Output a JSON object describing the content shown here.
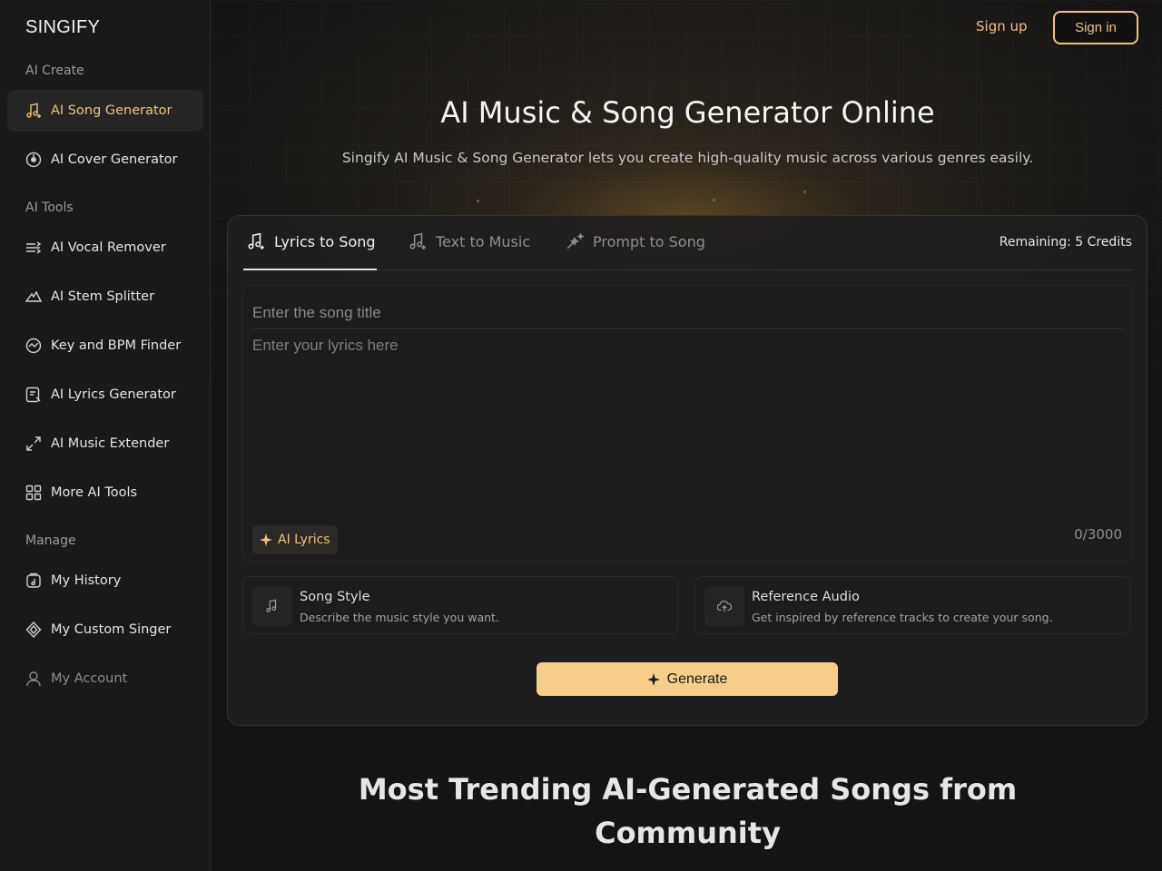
{
  "sidebar": {
    "logo": "SINGIFY",
    "sections": [
      {
        "label": "AI Create"
      },
      {
        "label": "AI Tools"
      },
      {
        "label": "Manage"
      }
    ],
    "items": [
      {
        "label": "AI Song Generator",
        "icon": "music-note-plus-icon"
      },
      {
        "label": "AI Cover Generator",
        "icon": "disc-icon"
      },
      {
        "label": "AI Vocal Remover",
        "icon": "split-icon"
      },
      {
        "label": "AI Stem Splitter",
        "icon": "layers-icon"
      },
      {
        "label": "Key and BPM Finder",
        "icon": "gauge-icon"
      },
      {
        "label": "AI Lyrics Generator",
        "icon": "lyrics-icon"
      },
      {
        "label": "AI Music Extender",
        "icon": "expand-icon"
      },
      {
        "label": "More AI Tools",
        "icon": "grid-icon"
      },
      {
        "label": "My History",
        "icon": "history-icon"
      },
      {
        "label": "My Custom Singer",
        "icon": "singer-icon"
      },
      {
        "label": "My Account",
        "icon": "user-icon"
      }
    ]
  },
  "header": {
    "signup": "Sign up",
    "signin": "Sign in"
  },
  "hero": {
    "title": "AI Music & Song Generator Online",
    "subtitle": "Singify AI Music & Song Generator lets you create high-quality music across various genres easily."
  },
  "generator": {
    "tabs": [
      {
        "label": "Lyrics to Song",
        "active": true
      },
      {
        "label": "Text to Music",
        "active": false
      },
      {
        "label": "Prompt to Song",
        "active": false
      }
    ],
    "credits": "Remaining: 5 Credits",
    "title_placeholder": "Enter the song title",
    "lyrics_placeholder": "Enter your lyrics here",
    "ai_lyrics_label": "AI Lyrics",
    "counter": "0/3000",
    "options": [
      {
        "title": "Song Style",
        "desc": "Describe the music style you want."
      },
      {
        "title": "Reference Audio",
        "desc": "Get inspired by reference tracks to create your song."
      }
    ],
    "generate_label": "Generate"
  },
  "trending": {
    "title_line1": "Most Trending AI-Generated Songs from",
    "title_line2": "Community"
  },
  "colors": {
    "accent": "#f4c07a",
    "generate_bg": "#f7cd8a",
    "background": "#131313"
  }
}
